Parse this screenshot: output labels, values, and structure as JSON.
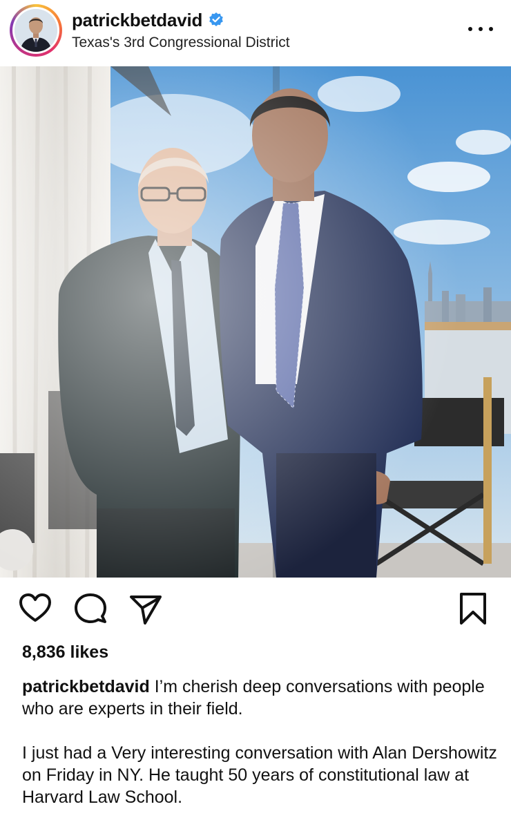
{
  "post": {
    "username": "patrickbetdavid",
    "verified": true,
    "location": "Texas's 3rd Congressional District",
    "likes_text": "8,836 likes",
    "caption_username": "patrickbetdavid",
    "caption_line1": " I’m cherish deep conversations with people who are experts in their field.",
    "caption_line2": "I just had a Very interesting conversation with Alan Dershowitz on Friday in NY.  He taught 50 years of constitutional law at Harvard Law School."
  },
  "icons": {
    "verified": "verified-badge-icon",
    "more": "more-options-icon",
    "like": "heart-icon",
    "comment": "comment-bubble-icon",
    "share": "paper-plane-icon",
    "save": "bookmark-icon"
  },
  "colors": {
    "verified_blue": "#3897f0",
    "text": "#111111"
  }
}
